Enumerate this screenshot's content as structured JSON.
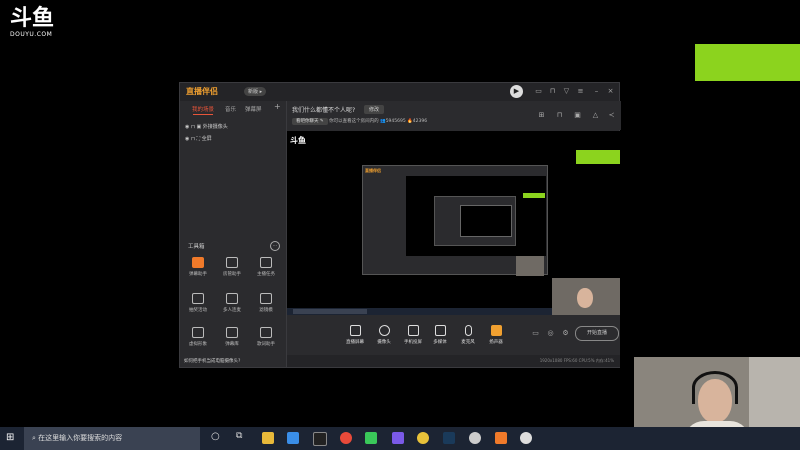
{
  "stream_overlay": {
    "logo_text": "斗鱼",
    "logo_sub": "DOUYU.COM"
  },
  "app": {
    "logo": "直播伴侣",
    "version_badge": "新版 ▸",
    "tabs": [
      "我的场景",
      "音乐",
      "弹幕屏"
    ],
    "add_tab": "+",
    "sources": [
      {
        "label": "外接摄像头"
      },
      {
        "label": "全屏"
      }
    ],
    "toolbox_title": "工具箱",
    "tools": [
      {
        "label": "弹幕助手"
      },
      {
        "label": "房管助手"
      },
      {
        "label": "主播任务"
      },
      {
        "label": "抽奖活动"
      },
      {
        "label": "多人连麦"
      },
      {
        "label": "滤镜模"
      },
      {
        "label": "虚拟形象"
      },
      {
        "label": "弹幕库"
      },
      {
        "label": "歌词助手"
      }
    ],
    "notice": "如何把手机当成电脑摄像头?",
    "room_title": "我们什么都懂不个人呢?",
    "edit_label": "修改",
    "category_pill": "看吧你聊天 ✎",
    "info_text": "你可以查看这个房间内的",
    "viewers": "5945695",
    "hot": "42396",
    "controls": [
      {
        "label": "直播屏幕"
      },
      {
        "label": "摄像头"
      },
      {
        "label": "手机投屏"
      },
      {
        "label": "多媒体"
      },
      {
        "label": "麦克风"
      },
      {
        "label": "扬声器"
      }
    ],
    "start_label": "开始直播",
    "status_text": "1920x1080   FPS:60   CPU:5%   内存:41%"
  },
  "taskbar": {
    "search_placeholder": "在这里输入你要搜索的内容",
    "start_icon": "windows-icon"
  },
  "colors": {
    "accent_green": "#8cd31e",
    "accent_orange": "#f07a2a",
    "taskbar_bg": "#1c2433"
  }
}
